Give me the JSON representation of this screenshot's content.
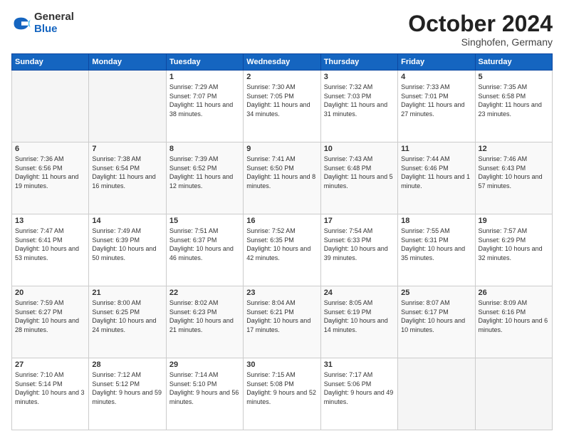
{
  "logo": {
    "general": "General",
    "blue": "Blue"
  },
  "title": "October 2024",
  "location": "Singhofen, Germany",
  "weekdays": [
    "Sunday",
    "Monday",
    "Tuesday",
    "Wednesday",
    "Thursday",
    "Friday",
    "Saturday"
  ],
  "weeks": [
    [
      {
        "day": "",
        "empty": true
      },
      {
        "day": "",
        "empty": true
      },
      {
        "day": "1",
        "sunrise": "7:29 AM",
        "sunset": "7:07 PM",
        "daylight": "11 hours and 38 minutes."
      },
      {
        "day": "2",
        "sunrise": "7:30 AM",
        "sunset": "7:05 PM",
        "daylight": "11 hours and 34 minutes."
      },
      {
        "day": "3",
        "sunrise": "7:32 AM",
        "sunset": "7:03 PM",
        "daylight": "11 hours and 31 minutes."
      },
      {
        "day": "4",
        "sunrise": "7:33 AM",
        "sunset": "7:01 PM",
        "daylight": "11 hours and 27 minutes."
      },
      {
        "day": "5",
        "sunrise": "7:35 AM",
        "sunset": "6:58 PM",
        "daylight": "11 hours and 23 minutes."
      }
    ],
    [
      {
        "day": "6",
        "sunrise": "7:36 AM",
        "sunset": "6:56 PM",
        "daylight": "11 hours and 19 minutes."
      },
      {
        "day": "7",
        "sunrise": "7:38 AM",
        "sunset": "6:54 PM",
        "daylight": "11 hours and 16 minutes."
      },
      {
        "day": "8",
        "sunrise": "7:39 AM",
        "sunset": "6:52 PM",
        "daylight": "11 hours and 12 minutes."
      },
      {
        "day": "9",
        "sunrise": "7:41 AM",
        "sunset": "6:50 PM",
        "daylight": "11 hours and 8 minutes."
      },
      {
        "day": "10",
        "sunrise": "7:43 AM",
        "sunset": "6:48 PM",
        "daylight": "11 hours and 5 minutes."
      },
      {
        "day": "11",
        "sunrise": "7:44 AM",
        "sunset": "6:46 PM",
        "daylight": "11 hours and 1 minute."
      },
      {
        "day": "12",
        "sunrise": "7:46 AM",
        "sunset": "6:43 PM",
        "daylight": "10 hours and 57 minutes."
      }
    ],
    [
      {
        "day": "13",
        "sunrise": "7:47 AM",
        "sunset": "6:41 PM",
        "daylight": "10 hours and 53 minutes."
      },
      {
        "day": "14",
        "sunrise": "7:49 AM",
        "sunset": "6:39 PM",
        "daylight": "10 hours and 50 minutes."
      },
      {
        "day": "15",
        "sunrise": "7:51 AM",
        "sunset": "6:37 PM",
        "daylight": "10 hours and 46 minutes."
      },
      {
        "day": "16",
        "sunrise": "7:52 AM",
        "sunset": "6:35 PM",
        "daylight": "10 hours and 42 minutes."
      },
      {
        "day": "17",
        "sunrise": "7:54 AM",
        "sunset": "6:33 PM",
        "daylight": "10 hours and 39 minutes."
      },
      {
        "day": "18",
        "sunrise": "7:55 AM",
        "sunset": "6:31 PM",
        "daylight": "10 hours and 35 minutes."
      },
      {
        "day": "19",
        "sunrise": "7:57 AM",
        "sunset": "6:29 PM",
        "daylight": "10 hours and 32 minutes."
      }
    ],
    [
      {
        "day": "20",
        "sunrise": "7:59 AM",
        "sunset": "6:27 PM",
        "daylight": "10 hours and 28 minutes."
      },
      {
        "day": "21",
        "sunrise": "8:00 AM",
        "sunset": "6:25 PM",
        "daylight": "10 hours and 24 minutes."
      },
      {
        "day": "22",
        "sunrise": "8:02 AM",
        "sunset": "6:23 PM",
        "daylight": "10 hours and 21 minutes."
      },
      {
        "day": "23",
        "sunrise": "8:04 AM",
        "sunset": "6:21 PM",
        "daylight": "10 hours and 17 minutes."
      },
      {
        "day": "24",
        "sunrise": "8:05 AM",
        "sunset": "6:19 PM",
        "daylight": "10 hours and 14 minutes."
      },
      {
        "day": "25",
        "sunrise": "8:07 AM",
        "sunset": "6:17 PM",
        "daylight": "10 hours and 10 minutes."
      },
      {
        "day": "26",
        "sunrise": "8:09 AM",
        "sunset": "6:16 PM",
        "daylight": "10 hours and 6 minutes."
      }
    ],
    [
      {
        "day": "27",
        "sunrise": "7:10 AM",
        "sunset": "5:14 PM",
        "daylight": "10 hours and 3 minutes."
      },
      {
        "day": "28",
        "sunrise": "7:12 AM",
        "sunset": "5:12 PM",
        "daylight": "9 hours and 59 minutes."
      },
      {
        "day": "29",
        "sunrise": "7:14 AM",
        "sunset": "5:10 PM",
        "daylight": "9 hours and 56 minutes."
      },
      {
        "day": "30",
        "sunrise": "7:15 AM",
        "sunset": "5:08 PM",
        "daylight": "9 hours and 52 minutes."
      },
      {
        "day": "31",
        "sunrise": "7:17 AM",
        "sunset": "5:06 PM",
        "daylight": "9 hours and 49 minutes."
      },
      {
        "day": "",
        "empty": true
      },
      {
        "day": "",
        "empty": true
      }
    ]
  ]
}
